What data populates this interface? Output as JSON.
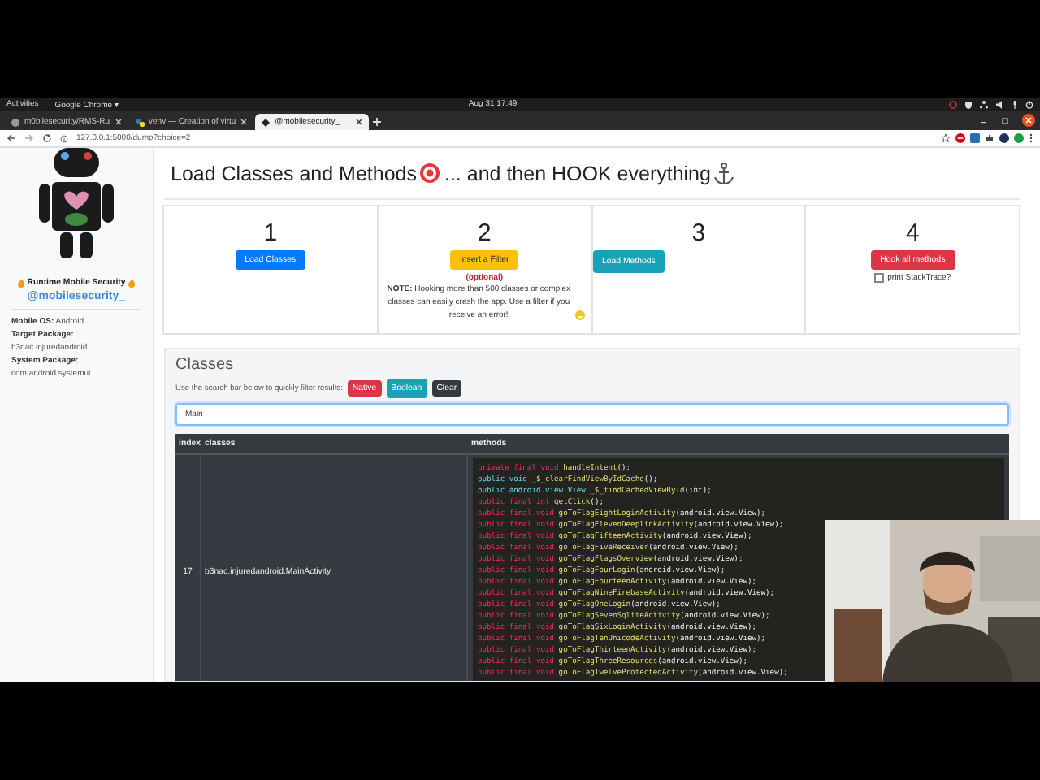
{
  "top_bar": {
    "activities": "Activities",
    "app_menu": "Google Chrome ▾",
    "clock": "Aug 31  17:49"
  },
  "browser": {
    "tabs": [
      {
        "title": "m0bilesecurity/RMS-Ru",
        "selected": false
      },
      {
        "title": "venv — Creation of virtu",
        "selected": false
      },
      {
        "title": "@mobilesecurity_",
        "selected": true
      }
    ],
    "url": "127.0.0.1:5000/dump?choice=2"
  },
  "sidebar": {
    "title": "Runtime Mobile Security",
    "handle": "@mobilesecurity_",
    "info": [
      {
        "label": "Mobile OS:",
        "value": "Android",
        "kind": "inline"
      },
      {
        "label": "Target Package:",
        "value": "b3nac.injuredandroid",
        "kind": "stacked"
      },
      {
        "label": "System Package:",
        "value": "com.android.systemui",
        "kind": "stacked"
      }
    ]
  },
  "heading": {
    "text_before": "Load Classes and Methods",
    "text_after": "... and then HOOK everything"
  },
  "steps": [
    {
      "number": "1",
      "button": "Load Classes",
      "kind": "primary"
    },
    {
      "number": "2",
      "button": "Insert a Filter",
      "kind": "warning",
      "optional": "(optional)",
      "note": "**NOTE:** Hooking more than 500 classes or complex classes can easily crash the app. Use a filter if you receive an error!"
    },
    {
      "number": "3",
      "button": "Load Methods",
      "kind": "info"
    },
    {
      "number": "4",
      "button": "Hook all methods",
      "kind": "danger",
      "checkbox": {
        "label": "print StackTrace?",
        "checked": false
      }
    }
  ],
  "classes": {
    "title": "Classes",
    "hint": "Use the search bar below to quickly filter results:",
    "filters": [
      {
        "label": "Native",
        "kind": "danger"
      },
      {
        "label": "Boolean",
        "kind": "info"
      },
      {
        "label": "Clear",
        "kind": "dark"
      }
    ],
    "search": {
      "value": "Main"
    },
    "table": {
      "columns": [
        "index",
        "classes",
        "methods"
      ],
      "rows": [
        {
          "index": "17",
          "class": "b3nac.injuredandroid.MainActivity",
          "methods": [
            {
              "kind": "final",
              "modifiers": "private final void",
              "name": "handleIntent",
              "args": "();"
            },
            {
              "kind": "plain",
              "modifiers": "public void",
              "name": "_$_clearFindViewByIdCache",
              "args": "();"
            },
            {
              "kind": "plain",
              "modifiers": "public android.view.View",
              "name": "_$_findCachedViewById",
              "args": "(int);"
            },
            {
              "kind": "final",
              "modifiers": "public final int",
              "name": "getClick",
              "args": "();"
            },
            {
              "kind": "final",
              "modifiers": "public final void",
              "name": "goToFlagEightLoginActivity",
              "args": "(android.view.View);"
            },
            {
              "kind": "final",
              "modifiers": "public final void",
              "name": "goToFlagElevenDeeplinkActivity",
              "args": "(android.view.View);"
            },
            {
              "kind": "final",
              "modifiers": "public final void",
              "name": "goToFlagFifteenActivity",
              "args": "(android.view.View);"
            },
            {
              "kind": "final",
              "modifiers": "public final void",
              "name": "goToFlagFiveReceiver",
              "args": "(android.view.View);"
            },
            {
              "kind": "final",
              "modifiers": "public final void",
              "name": "goToFlagFlagsOverview",
              "args": "(android.view.View);"
            },
            {
              "kind": "final",
              "modifiers": "public final void",
              "name": "goToFlagFourLogin",
              "args": "(android.view.View);"
            },
            {
              "kind": "final",
              "modifiers": "public final void",
              "name": "goToFlagFourteenActivity",
              "args": "(android.view.View);"
            },
            {
              "kind": "final",
              "modifiers": "public final void",
              "name": "goToFlagNineFirebaseActivity",
              "args": "(android.view.View);"
            },
            {
              "kind": "final",
              "modifiers": "public final void",
              "name": "goToFlagOneLogin",
              "args": "(android.view.View);"
            },
            {
              "kind": "final",
              "modifiers": "public final void",
              "name": "goToFlagSevenSqliteActivity",
              "args": "(android.view.View);"
            },
            {
              "kind": "final",
              "modifiers": "public final void",
              "name": "goToFlagSixLoginActivity",
              "args": "(android.view.View);"
            },
            {
              "kind": "final",
              "modifiers": "public final void",
              "name": "goToFlagTenUnicodeActivity",
              "args": "(android.view.View);"
            },
            {
              "kind": "final",
              "modifiers": "public final void",
              "name": "goToFlagThirteenActivity",
              "args": "(android.view.View);"
            },
            {
              "kind": "final",
              "modifiers": "public final void",
              "name": "goToFlagThreeResources",
              "args": "(android.view.View);"
            },
            {
              "kind": "final",
              "modifiers": "public final void",
              "name": "goToFlagTwelveProtectedActivity",
              "args": "(android.view.View);"
            }
          ]
        }
      ]
    }
  }
}
